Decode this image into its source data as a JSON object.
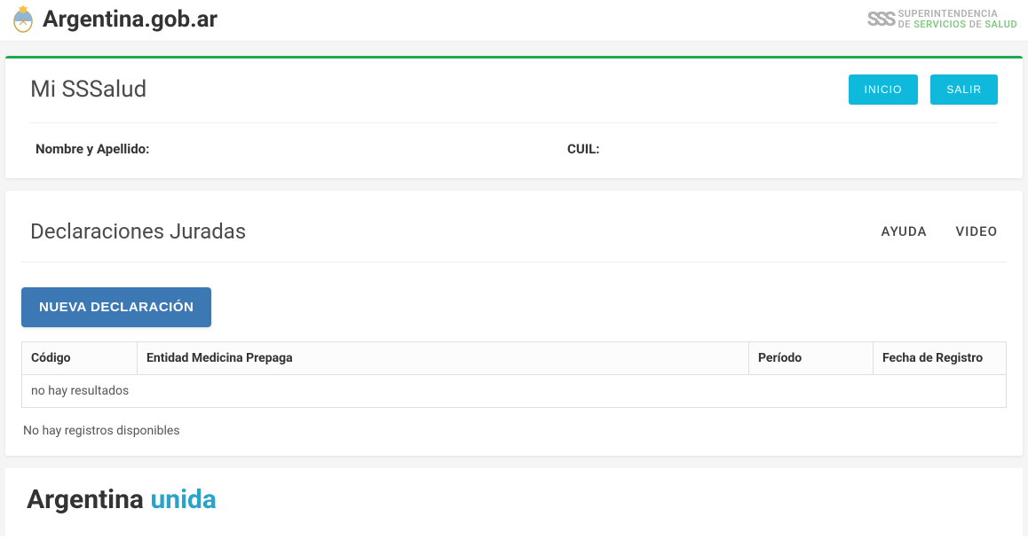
{
  "header": {
    "site_title": "Argentina.gob.ar",
    "org_line1_a": "SUPERINTENDENCIA",
    "org_line2_a": "DE ",
    "org_line2_b": "SERVICIOS",
    "org_line2_c": " DE ",
    "org_line2_d": "SALUD",
    "sss_mark": "SSS"
  },
  "profile_card": {
    "title": "Mi SSSalud",
    "buttons": {
      "inicio": "INICIO",
      "salir": "SALIR"
    },
    "name_label": "Nombre y Apellido:",
    "name_value": "",
    "cuil_label": "CUIL:",
    "cuil_value": ""
  },
  "declarations": {
    "title": "Declaraciones Juradas",
    "links": {
      "ayuda": "AYUDA",
      "video": "VIDEO"
    },
    "new_button": "NUEVA DECLARACIÓN",
    "table": {
      "headers": {
        "codigo": "Código",
        "entidad": "Entidad Medicina Prepaga",
        "periodo": "Período",
        "fecha": "Fecha de Registro"
      },
      "empty_row": "no hay resultados"
    },
    "footer_text": "No hay registros disponibles"
  },
  "footer": {
    "brand_a": "Argentina ",
    "brand_b": "unida"
  }
}
